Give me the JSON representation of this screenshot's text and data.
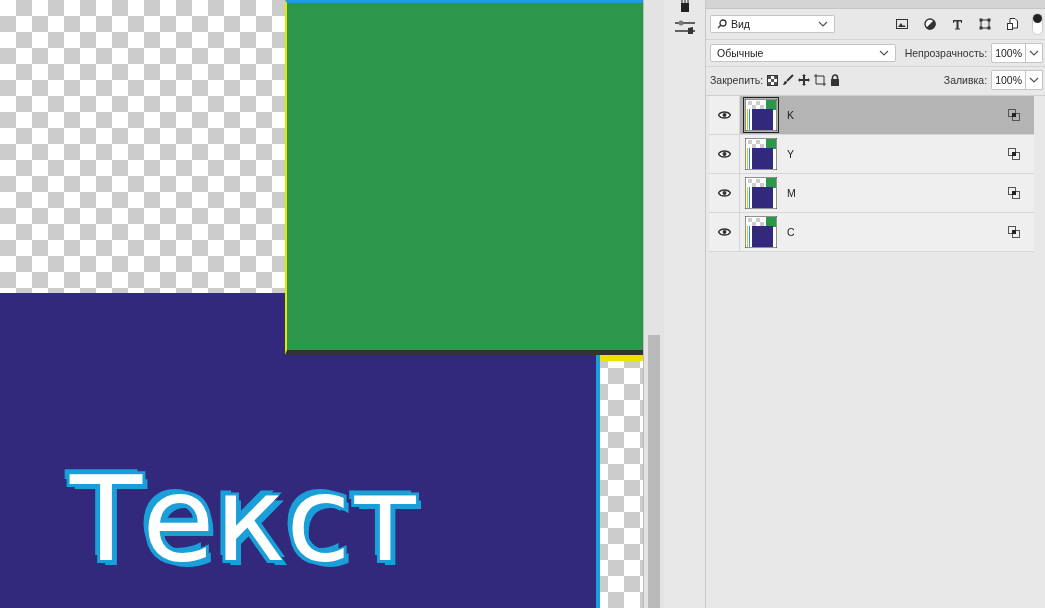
{
  "canvas": {
    "text": "Текст"
  },
  "layers_panel": {
    "filter": {
      "value": "Вид"
    },
    "blend_mode": {
      "value": "Обычные"
    },
    "opacity": {
      "label": "Непрозрачность:",
      "value": "100%"
    },
    "lock": {
      "label": "Закрепить:"
    },
    "fill": {
      "label": "Заливка:",
      "value": "100%"
    },
    "layers": [
      {
        "name": "K",
        "visible": true,
        "selected": true
      },
      {
        "name": "Y",
        "visible": true,
        "selected": false
      },
      {
        "name": "M",
        "visible": true,
        "selected": false
      },
      {
        "name": "C",
        "visible": true,
        "selected": false
      }
    ]
  }
}
